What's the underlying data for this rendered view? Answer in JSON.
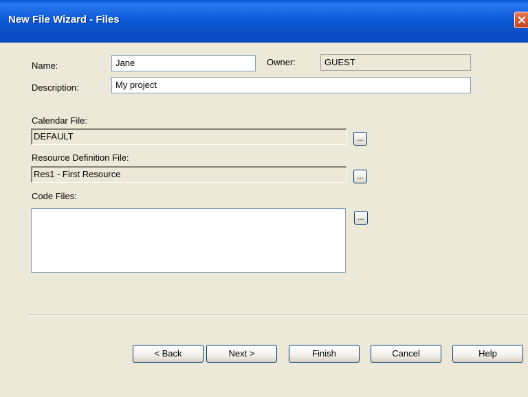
{
  "window": {
    "title": "New File Wizard - Files"
  },
  "form": {
    "name_label": "Name:",
    "name_value": "Jane",
    "owner_label": "Owner:",
    "owner_value": "GUEST",
    "description_label": "Description:",
    "description_value": "My project",
    "calendar_label": "Calendar File:",
    "calendar_value": "DEFAULT",
    "resource_label": "Resource Definition File:",
    "resource_value": "Res1 - First Resource",
    "code_label": "Code Files:",
    "browse_label": "..."
  },
  "buttons": {
    "back": "< Back",
    "next": "Next >",
    "finish": "Finish",
    "cancel": "Cancel",
    "help": "Help"
  },
  "colors": {
    "titlebar": "#0a58d6",
    "dialog_bg": "#ece9d8",
    "close_button": "#d7582f"
  }
}
